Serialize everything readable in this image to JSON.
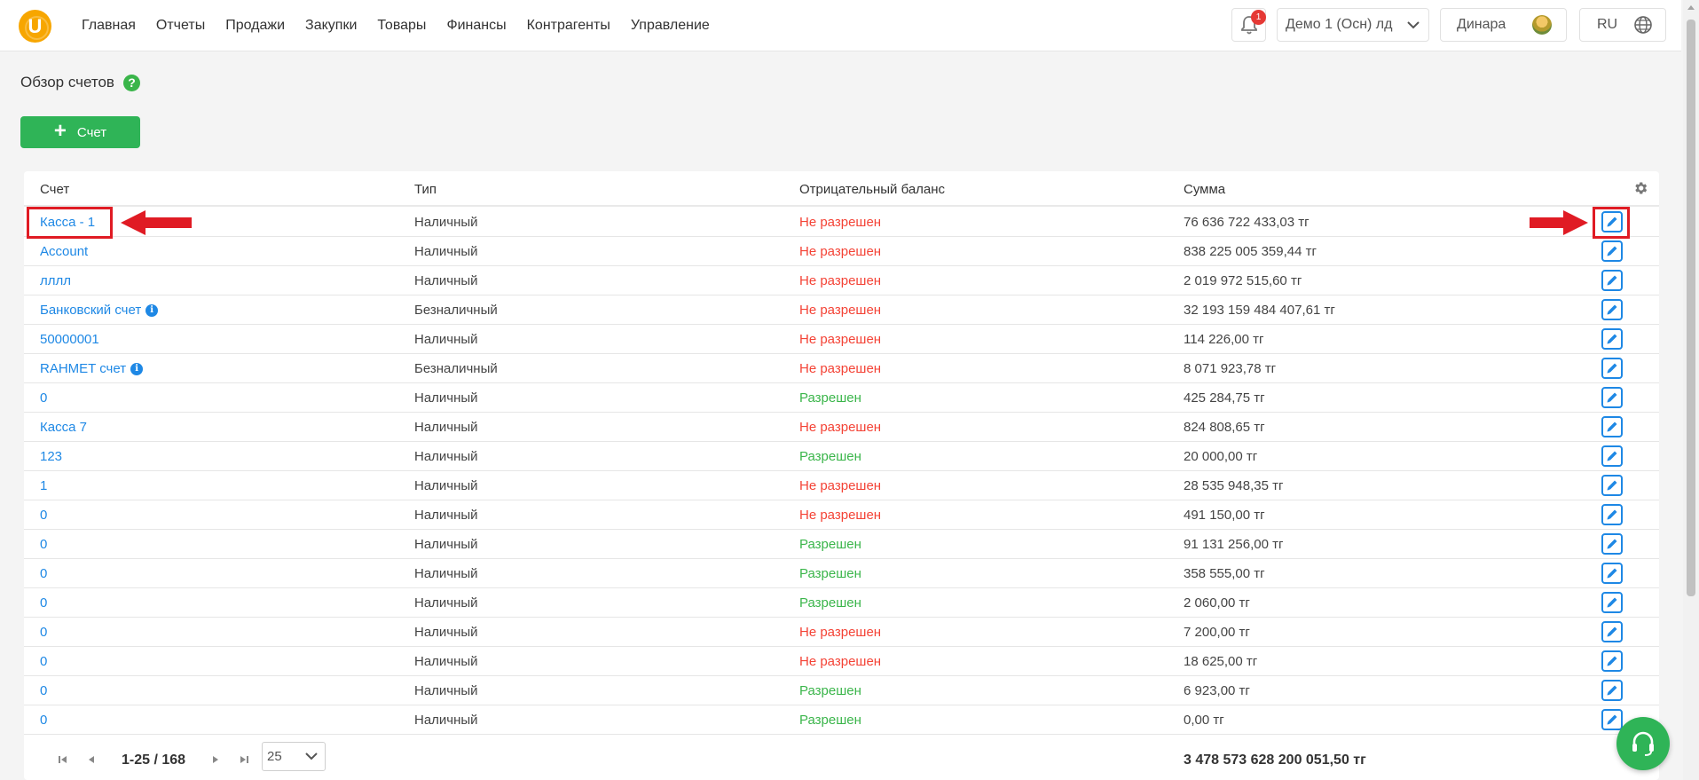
{
  "header": {
    "logo_letter": "U",
    "nav": [
      "Главная",
      "Отчеты",
      "Продажи",
      "Закупки",
      "Товары",
      "Финансы",
      "Контрагенты",
      "Управление"
    ],
    "notification_count": "1",
    "company": "Демо 1 (Осн) лд",
    "user": "Динара",
    "language": "RU"
  },
  "page": {
    "title": "Обзор счетов",
    "add_button_label": "Счет"
  },
  "table": {
    "columns": [
      "Счет",
      "Тип",
      "Отрицательный баланс",
      "Сумма"
    ],
    "rows": [
      {
        "account": "Касса - 1",
        "info": false,
        "type": "Наличный",
        "negative": "Не разрешен",
        "allowed": false,
        "sum": "76 636 722 433,03 тг"
      },
      {
        "account": "Account",
        "info": false,
        "type": "Наличный",
        "negative": "Не разрешен",
        "allowed": false,
        "sum": "838 225 005 359,44 тг"
      },
      {
        "account": "лллл",
        "info": false,
        "type": "Наличный",
        "negative": "Не разрешен",
        "allowed": false,
        "sum": "2 019 972 515,60 тг"
      },
      {
        "account": "Банковский счет",
        "info": true,
        "type": "Безналичный",
        "negative": "Не разрешен",
        "allowed": false,
        "sum": "32 193 159 484 407,61 тг"
      },
      {
        "account": "50000001",
        "info": false,
        "type": "Наличный",
        "negative": "Не разрешен",
        "allowed": false,
        "sum": "114 226,00 тг"
      },
      {
        "account": "RAHMET счет",
        "info": true,
        "type": "Безналичный",
        "negative": "Не разрешен",
        "allowed": false,
        "sum": "8 071 923,78 тг"
      },
      {
        "account": "0",
        "info": false,
        "type": "Наличный",
        "negative": "Разрешен",
        "allowed": true,
        "sum": "425 284,75 тг"
      },
      {
        "account": "Касса 7",
        "info": false,
        "type": "Наличный",
        "negative": "Не разрешен",
        "allowed": false,
        "sum": "824 808,65 тг"
      },
      {
        "account": "123",
        "info": false,
        "type": "Наличный",
        "negative": "Разрешен",
        "allowed": true,
        "sum": "20 000,00 тг"
      },
      {
        "account": "1",
        "info": false,
        "type": "Наличный",
        "negative": "Не разрешен",
        "allowed": false,
        "sum": "28 535 948,35 тг"
      },
      {
        "account": "0",
        "info": false,
        "type": "Наличный",
        "negative": "Не разрешен",
        "allowed": false,
        "sum": "491 150,00 тг"
      },
      {
        "account": "0",
        "info": false,
        "type": "Наличный",
        "negative": "Разрешен",
        "allowed": true,
        "sum": "91 131 256,00 тг"
      },
      {
        "account": "0",
        "info": false,
        "type": "Наличный",
        "negative": "Разрешен",
        "allowed": true,
        "sum": "358 555,00 тг"
      },
      {
        "account": "0",
        "info": false,
        "type": "Наличный",
        "negative": "Разрешен",
        "allowed": true,
        "sum": "2 060,00 тг"
      },
      {
        "account": "0",
        "info": false,
        "type": "Наличный",
        "negative": "Не разрешен",
        "allowed": false,
        "sum": "7 200,00 тг"
      },
      {
        "account": "0",
        "info": false,
        "type": "Наличный",
        "negative": "Не разрешен",
        "allowed": false,
        "sum": "18 625,00 тг"
      },
      {
        "account": "0",
        "info": false,
        "type": "Наличный",
        "negative": "Разрешен",
        "allowed": true,
        "sum": "6 923,00 тг"
      },
      {
        "account": "0",
        "info": false,
        "type": "Наличный",
        "negative": "Разрешен",
        "allowed": true,
        "sum": "0,00 тг"
      }
    ]
  },
  "pagination": {
    "range": "1-25 / 168",
    "page_size": "25",
    "total": "3 478 573 628 200 051,50 тг"
  },
  "colors": {
    "accent_green": "#2fb457",
    "link_blue": "#1e88e5",
    "negative_red": "#f44336",
    "positive_green": "#3ab54a",
    "annotation_red": "#e01b24",
    "logo_orange": "#f7a600"
  },
  "icons": [
    "bell-icon",
    "chevron-down-icon",
    "globe-icon",
    "help-icon",
    "plus-icon",
    "gear-icon",
    "info-icon",
    "edit-icon",
    "first-page-icon",
    "prev-page-icon",
    "next-page-icon",
    "last-page-icon",
    "headset-icon",
    "arrow-annotation"
  ]
}
